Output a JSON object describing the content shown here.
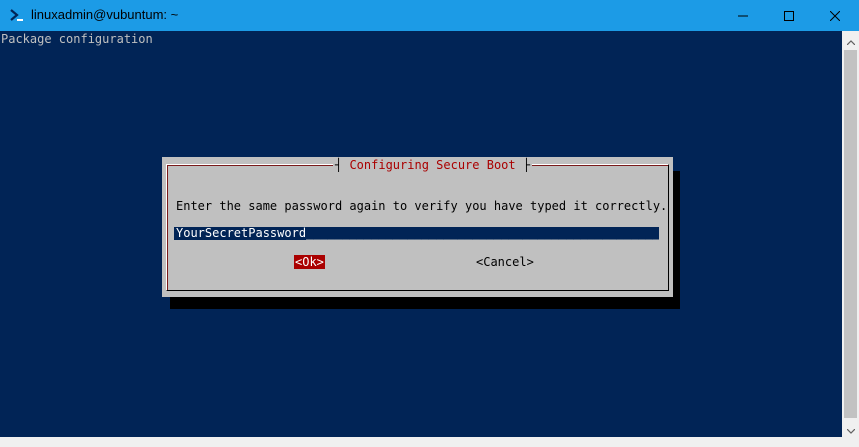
{
  "window": {
    "title": "linuxadmin@vubuntum: ~",
    "icon": "terminal-icon",
    "titlebar_color": "#1c9be6",
    "controls": [
      "minimize-icon",
      "maximize-icon",
      "close-icon"
    ]
  },
  "console": {
    "background": "#012456",
    "header_text": "Package configuration"
  },
  "dialog": {
    "title": "Configuring Secure Boot",
    "message": "Enter the same password again to verify you have typed it correctly.",
    "password_value": "YourSecretPassword",
    "ok_label": "<Ok>",
    "cancel_label": "<Cancel>",
    "accent_color": "#aa0000",
    "background": "#c0c0c0"
  }
}
